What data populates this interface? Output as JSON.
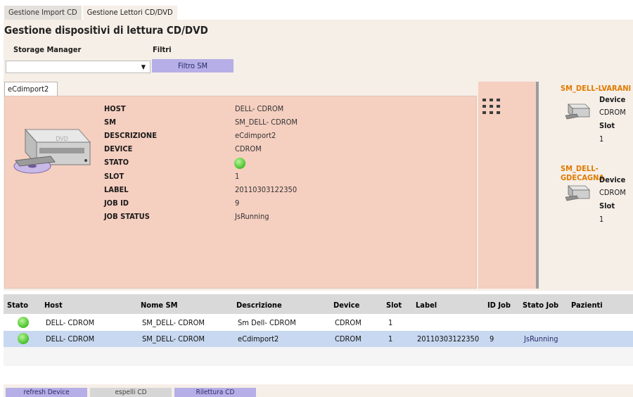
{
  "tabs": [
    {
      "label": "Gestione Import CD"
    },
    {
      "label": "Gestione Lettori CD/DVD"
    }
  ],
  "page_title": "Gestione dispositivi di lettura CD/DVD",
  "filters": {
    "storage_manager_label": "Storage Manager",
    "filtri_label": "Filtri",
    "storage_manager_value": "",
    "filter_button": "Filtro SM"
  },
  "drive": {
    "tab_label": "eCdimport2",
    "fields": [
      {
        "label": "HOST",
        "value": "DELL-  CDROM"
      },
      {
        "label": "SM",
        "value": "SM_DELL- CDROM"
      },
      {
        "label": "DESCRIZIONE",
        "value": "eCdimport2"
      },
      {
        "label": "DEVICE",
        "value": "CDROM"
      },
      {
        "label": "STATO",
        "value": ""
      },
      {
        "label": "SLOT",
        "value": "1"
      },
      {
        "label": "LABEL",
        "value": "20110303122350"
      },
      {
        "label": "JOB ID",
        "value": "9"
      },
      {
        "label": "JOB STATUS",
        "value": "JsRunning"
      }
    ],
    "status_color": "#47c02a"
  },
  "side_panels": [
    {
      "title": "SM_DELL-LVARANI",
      "device_label": "Device",
      "device_value": "CDROM",
      "slot_label": "Slot",
      "slot_value": "1"
    },
    {
      "title": "SM_DELL-GDECAGNA",
      "device_label": "Device",
      "device_value": "CDROM",
      "slot_label": "Slot",
      "slot_value": "1"
    }
  ],
  "grid": {
    "columns": [
      "Stato",
      "Host",
      "Nome SM",
      "Descrizione",
      "Device",
      "Slot",
      "Label",
      "ID Job",
      "Stato Job",
      "Pazienti"
    ],
    "rows": [
      {
        "host": "DELL- CDROM",
        "nome_sm": "SM_DELL- CDROM",
        "descrizione": "Sm Dell- CDROM",
        "device": "CDROM",
        "slot": "1",
        "label": "",
        "id_job": "",
        "stato_job": "",
        "pazienti": ""
      },
      {
        "host": "DELL- CDROM",
        "nome_sm": "SM_DELL- CDROM",
        "descrizione": "eCdimport2",
        "device": "CDROM",
        "slot": "1",
        "label": "20110303122350",
        "id_job": "9",
        "stato_job": "JsRunning",
        "pazienti": ""
      }
    ]
  },
  "bottom_buttons": {
    "refresh": "refresh Device",
    "espelli": "espelli CD",
    "rilettura": "Rilettura CD"
  },
  "colors": {
    "accent_orange": "#e07a00",
    "panel_pink": "#f5cfc0",
    "button_purple": "#b6aee6",
    "selected_row": "#c8d8f0"
  }
}
